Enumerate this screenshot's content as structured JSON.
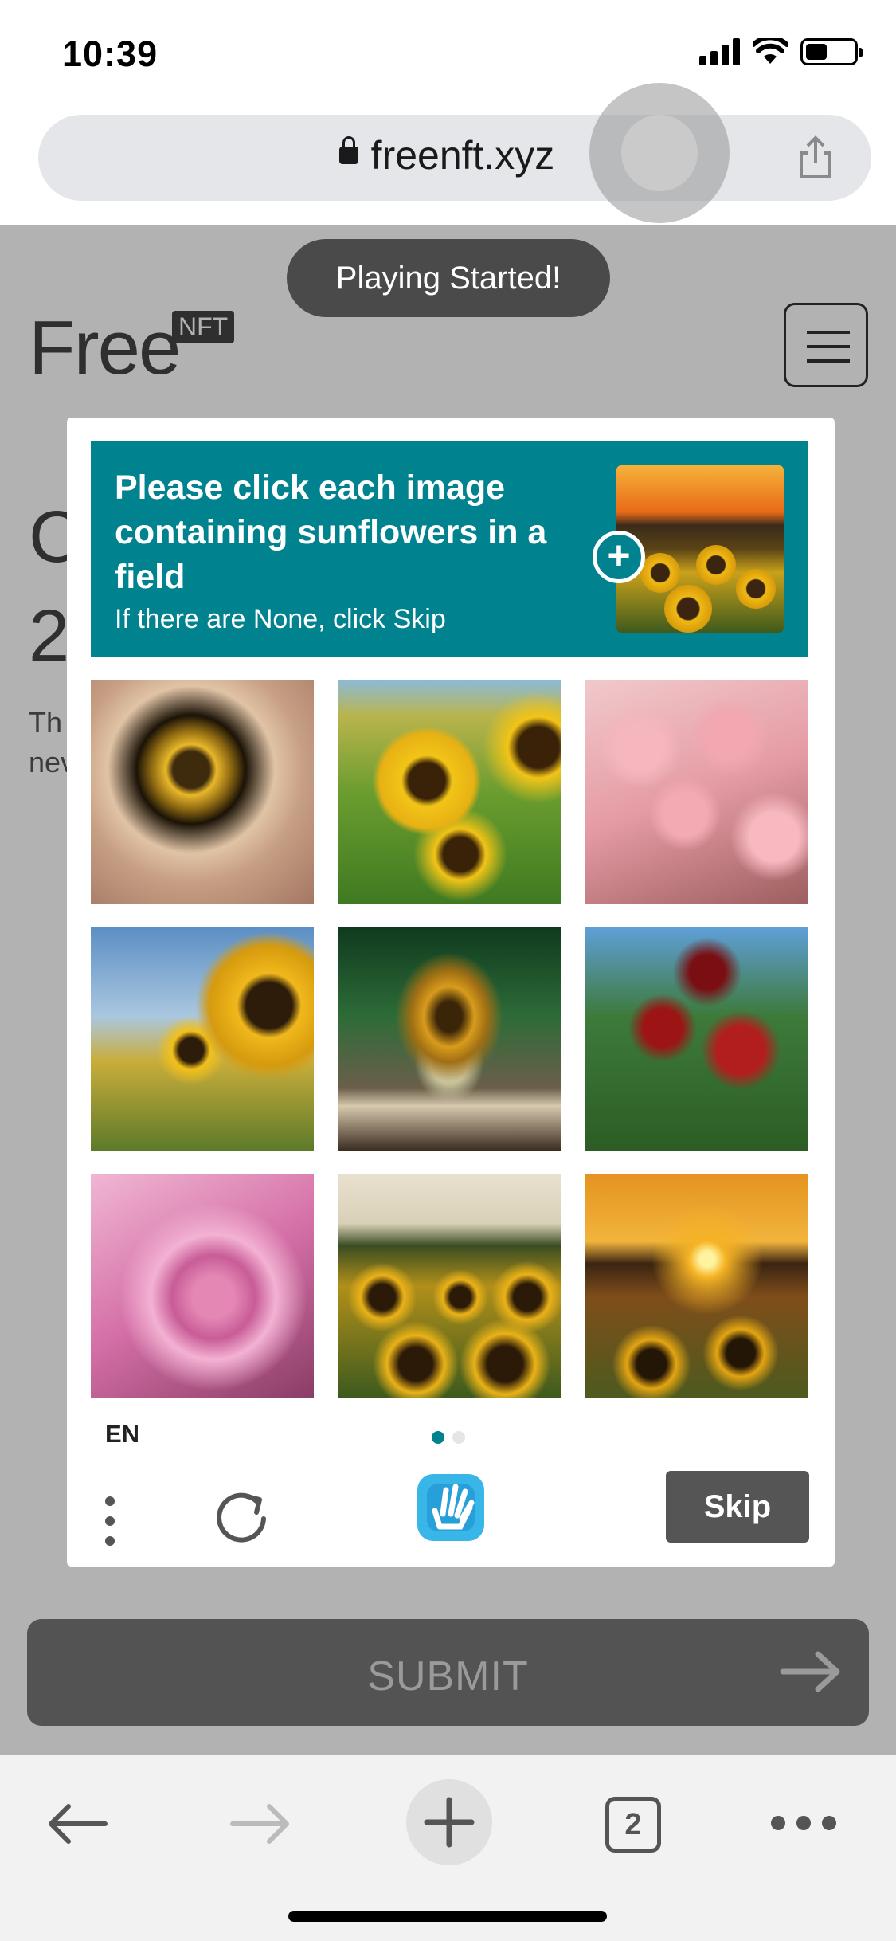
{
  "status_bar": {
    "time": "10:39"
  },
  "browser": {
    "url": "freenft.xyz",
    "tab_count": "2"
  },
  "site": {
    "logo": "Free",
    "logo_badge": "NFT",
    "heading_fragment_1": "C",
    "heading_fragment_2": "2",
    "text_fragment_1": "Th",
    "text_fragment_2": "nev",
    "submit_label": "SUBMIT"
  },
  "toast": {
    "text": "Playing Started!"
  },
  "captcha": {
    "prompt": "Please click each image containing sunflowers in a field",
    "sub_prompt": "If there are None, click Skip",
    "language": "EN",
    "skip_label": "Skip",
    "accent_color": "#00838f",
    "tiles": [
      {
        "id": "tile-1"
      },
      {
        "id": "tile-2"
      },
      {
        "id": "tile-3"
      },
      {
        "id": "tile-4"
      },
      {
        "id": "tile-5"
      },
      {
        "id": "tile-6"
      },
      {
        "id": "tile-7"
      },
      {
        "id": "tile-8"
      },
      {
        "id": "tile-9"
      }
    ],
    "pages": {
      "current": 1,
      "total": 2
    }
  },
  "icons": {
    "lock": "lock-icon",
    "share": "share-icon",
    "menu": "hamburger-menu-icon",
    "add": "plus-icon",
    "more": "vertical-dots-icon",
    "refresh": "refresh-icon",
    "logo": "hand-logo-icon",
    "back": "arrow-left-icon",
    "forward": "arrow-right-icon",
    "new_tab": "plus-icon",
    "overflow": "horizontal-dots-icon"
  }
}
